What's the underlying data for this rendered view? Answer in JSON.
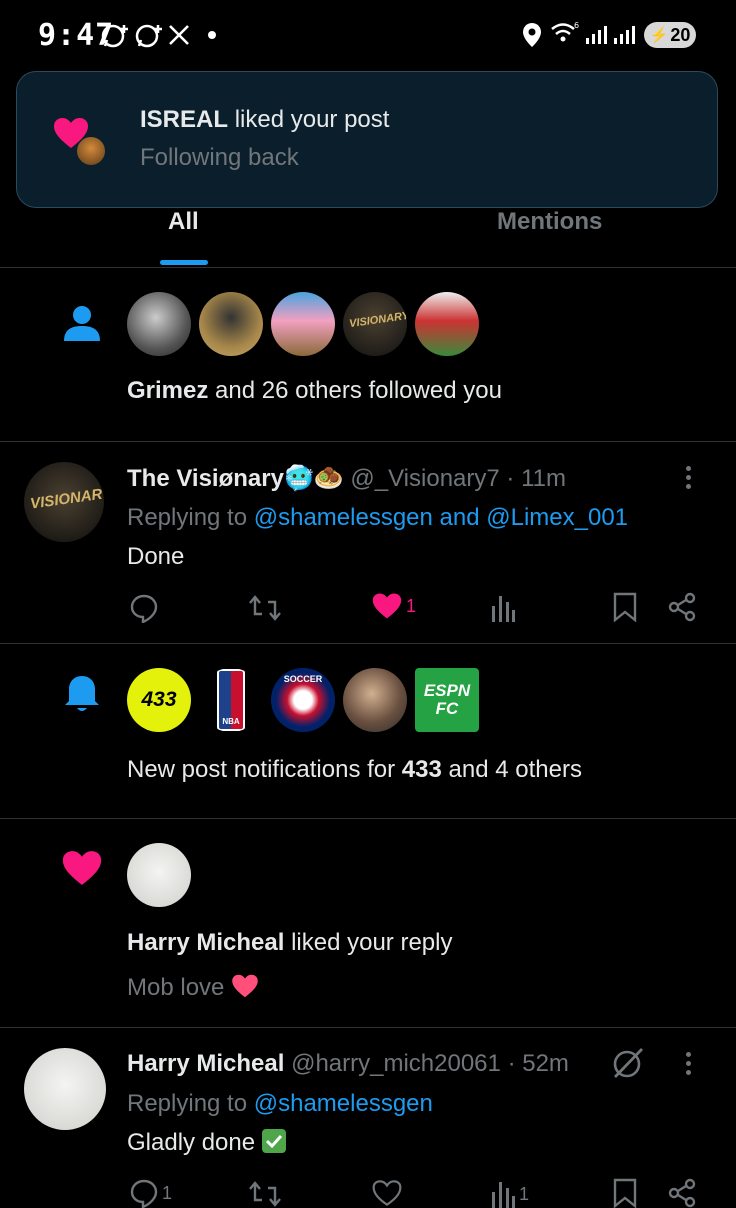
{
  "status_bar": {
    "time": "9:47",
    "battery": "20"
  },
  "toast": {
    "user": "ISREAL",
    "action": "liked your post",
    "subtitle": "Following back"
  },
  "tabs": {
    "all": "All",
    "mentions": "Mentions"
  },
  "follow_notification": {
    "name": "Grimez",
    "rest": "and 26 others followed you"
  },
  "tweet1": {
    "name": "The Visiønary",
    "handle": "@_Visionary7",
    "time": "· 11m",
    "replying_prefix": "Replying to",
    "replying_to": "@shamelessgen and @Limex_001",
    "text": "Done",
    "likes": "1"
  },
  "post_notification": {
    "prefix": "New post notifications for",
    "bold": "433",
    "suffix": "and 4 others",
    "avatars": [
      "433",
      "NBA",
      "SOCCER",
      "person",
      "ESPN FC"
    ]
  },
  "like_notification": {
    "name": "Harry Micheal",
    "action": "liked your reply",
    "quote": "Mob love"
  },
  "tweet2": {
    "name": "Harry Micheal",
    "handle": "@harry_mich20061",
    "time": "· 52m",
    "replying_prefix": "Replying to",
    "replying_to": "@shamelessgen",
    "text": "Gladly done",
    "replies": "1",
    "views": "1"
  },
  "colors": {
    "accent": "#1d9bf0",
    "like": "#f91880",
    "muted": "#71767b"
  }
}
